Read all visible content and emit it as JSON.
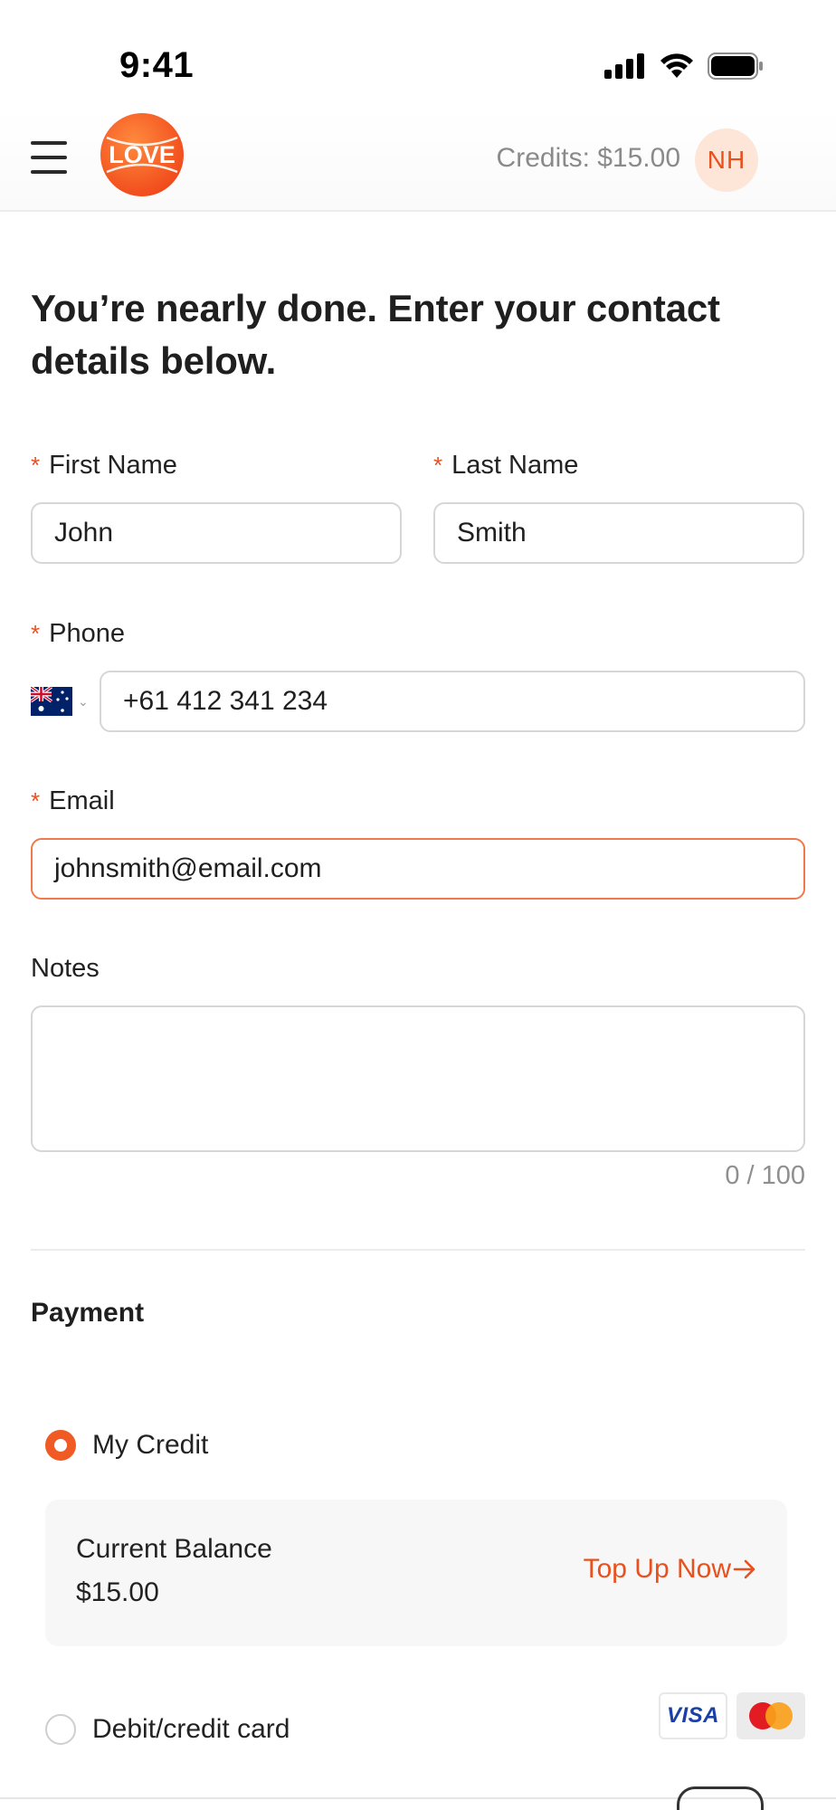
{
  "status_bar": {
    "time": "9:41"
  },
  "header": {
    "logo_text": "LOVE",
    "credits": "Credits: $15.00",
    "avatar_initials": "NH"
  },
  "page": {
    "title": "You’re nearly done. Enter your contact details below."
  },
  "form": {
    "required_mark": "*",
    "first_name": {
      "label": "First Name",
      "value": "John"
    },
    "last_name": {
      "label": "Last Name",
      "value": "Smith"
    },
    "phone": {
      "label": "Phone",
      "country": "Australia",
      "value": "+61 412 341 234"
    },
    "email": {
      "label": "Email",
      "value": "johnsmith@email.com"
    },
    "notes": {
      "label": "Notes",
      "value": "",
      "counter": "0 / 100"
    }
  },
  "payment": {
    "title": "Payment",
    "options": [
      {
        "label": "My Credit",
        "selected": true
      },
      {
        "label": "Debit/credit card",
        "selected": false
      }
    ],
    "balance": {
      "label": "Current Balance",
      "value": "$15.00",
      "top_up": "Top Up Now"
    },
    "card_brands": [
      "VISA",
      "Mastercard"
    ]
  },
  "colors": {
    "accent": "#e8501e",
    "radio_selected": "#f05a24",
    "email_focus_border": "#f0794a",
    "avatar_bg": "#fde6d8"
  }
}
